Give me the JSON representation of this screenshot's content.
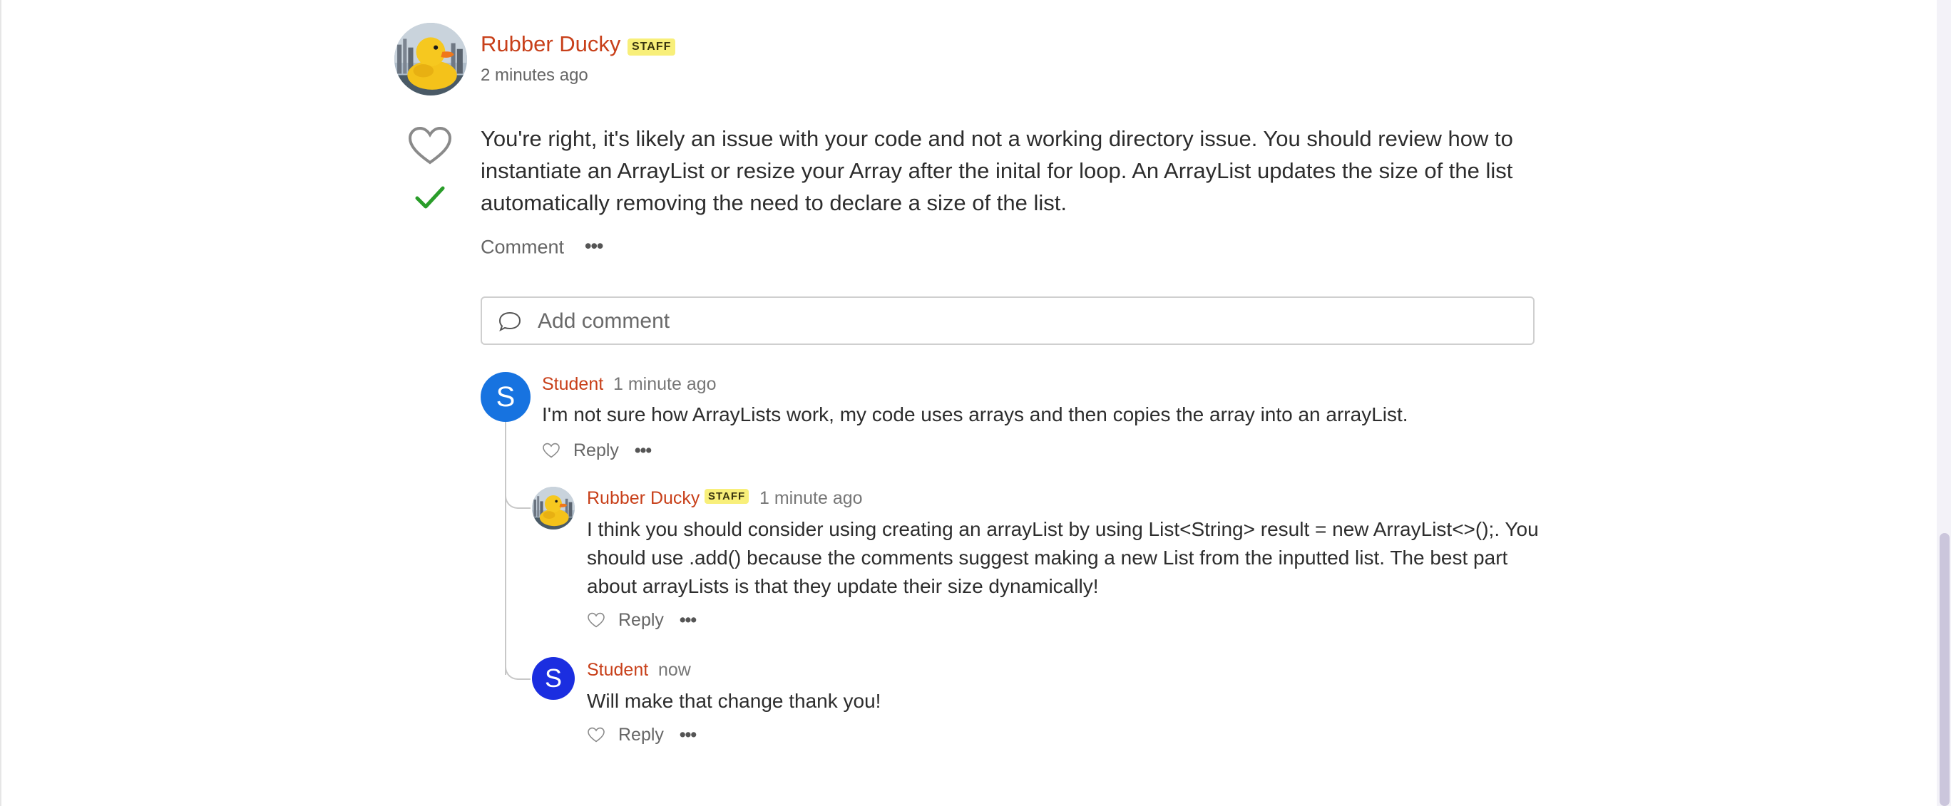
{
  "post": {
    "author": "Rubber Ducky",
    "badge": "STAFF",
    "time": "2 minutes ago",
    "body": "You're right, it's likely an issue with your code and not a working directory issue. You should review how to instantiate an ArrayList or resize your Array after the inital for loop. An ArrayList updates the size of the list automatically removing the need to declare a size of the list.",
    "comment_label": "Comment",
    "more_label": "•••",
    "endorsed_color": "#2a9d2a"
  },
  "add_comment": {
    "placeholder": "Add comment"
  },
  "comments": [
    {
      "author": "Student",
      "avatar_letter": "S",
      "avatar_color": "#1773e0",
      "time": "1 minute ago",
      "body": "I'm not sure how ArrayLists work, my code uses arrays and then copies the array into an arrayList.",
      "reply_label": "Reply",
      "more_label": "•••"
    },
    {
      "author": "Rubber Ducky",
      "badge": "STAFF",
      "time": "1 minute ago",
      "body": "I think you should consider using creating an arrayList by using List<String> result = new ArrayList<>();. You should use .add() because the comments suggest making a new List from the inputted list. The best part about arrayLists is that they update their size dynamically!",
      "reply_label": "Reply",
      "more_label": "•••"
    },
    {
      "author": "Student",
      "avatar_letter": "S",
      "avatar_color": "#1b2ee0",
      "time": "now",
      "body": "Will make that change thank you!",
      "reply_label": "Reply",
      "more_label": "•••"
    }
  ],
  "colors": {
    "author": "#c8401a",
    "badge_bg": "#f8ef7a"
  }
}
